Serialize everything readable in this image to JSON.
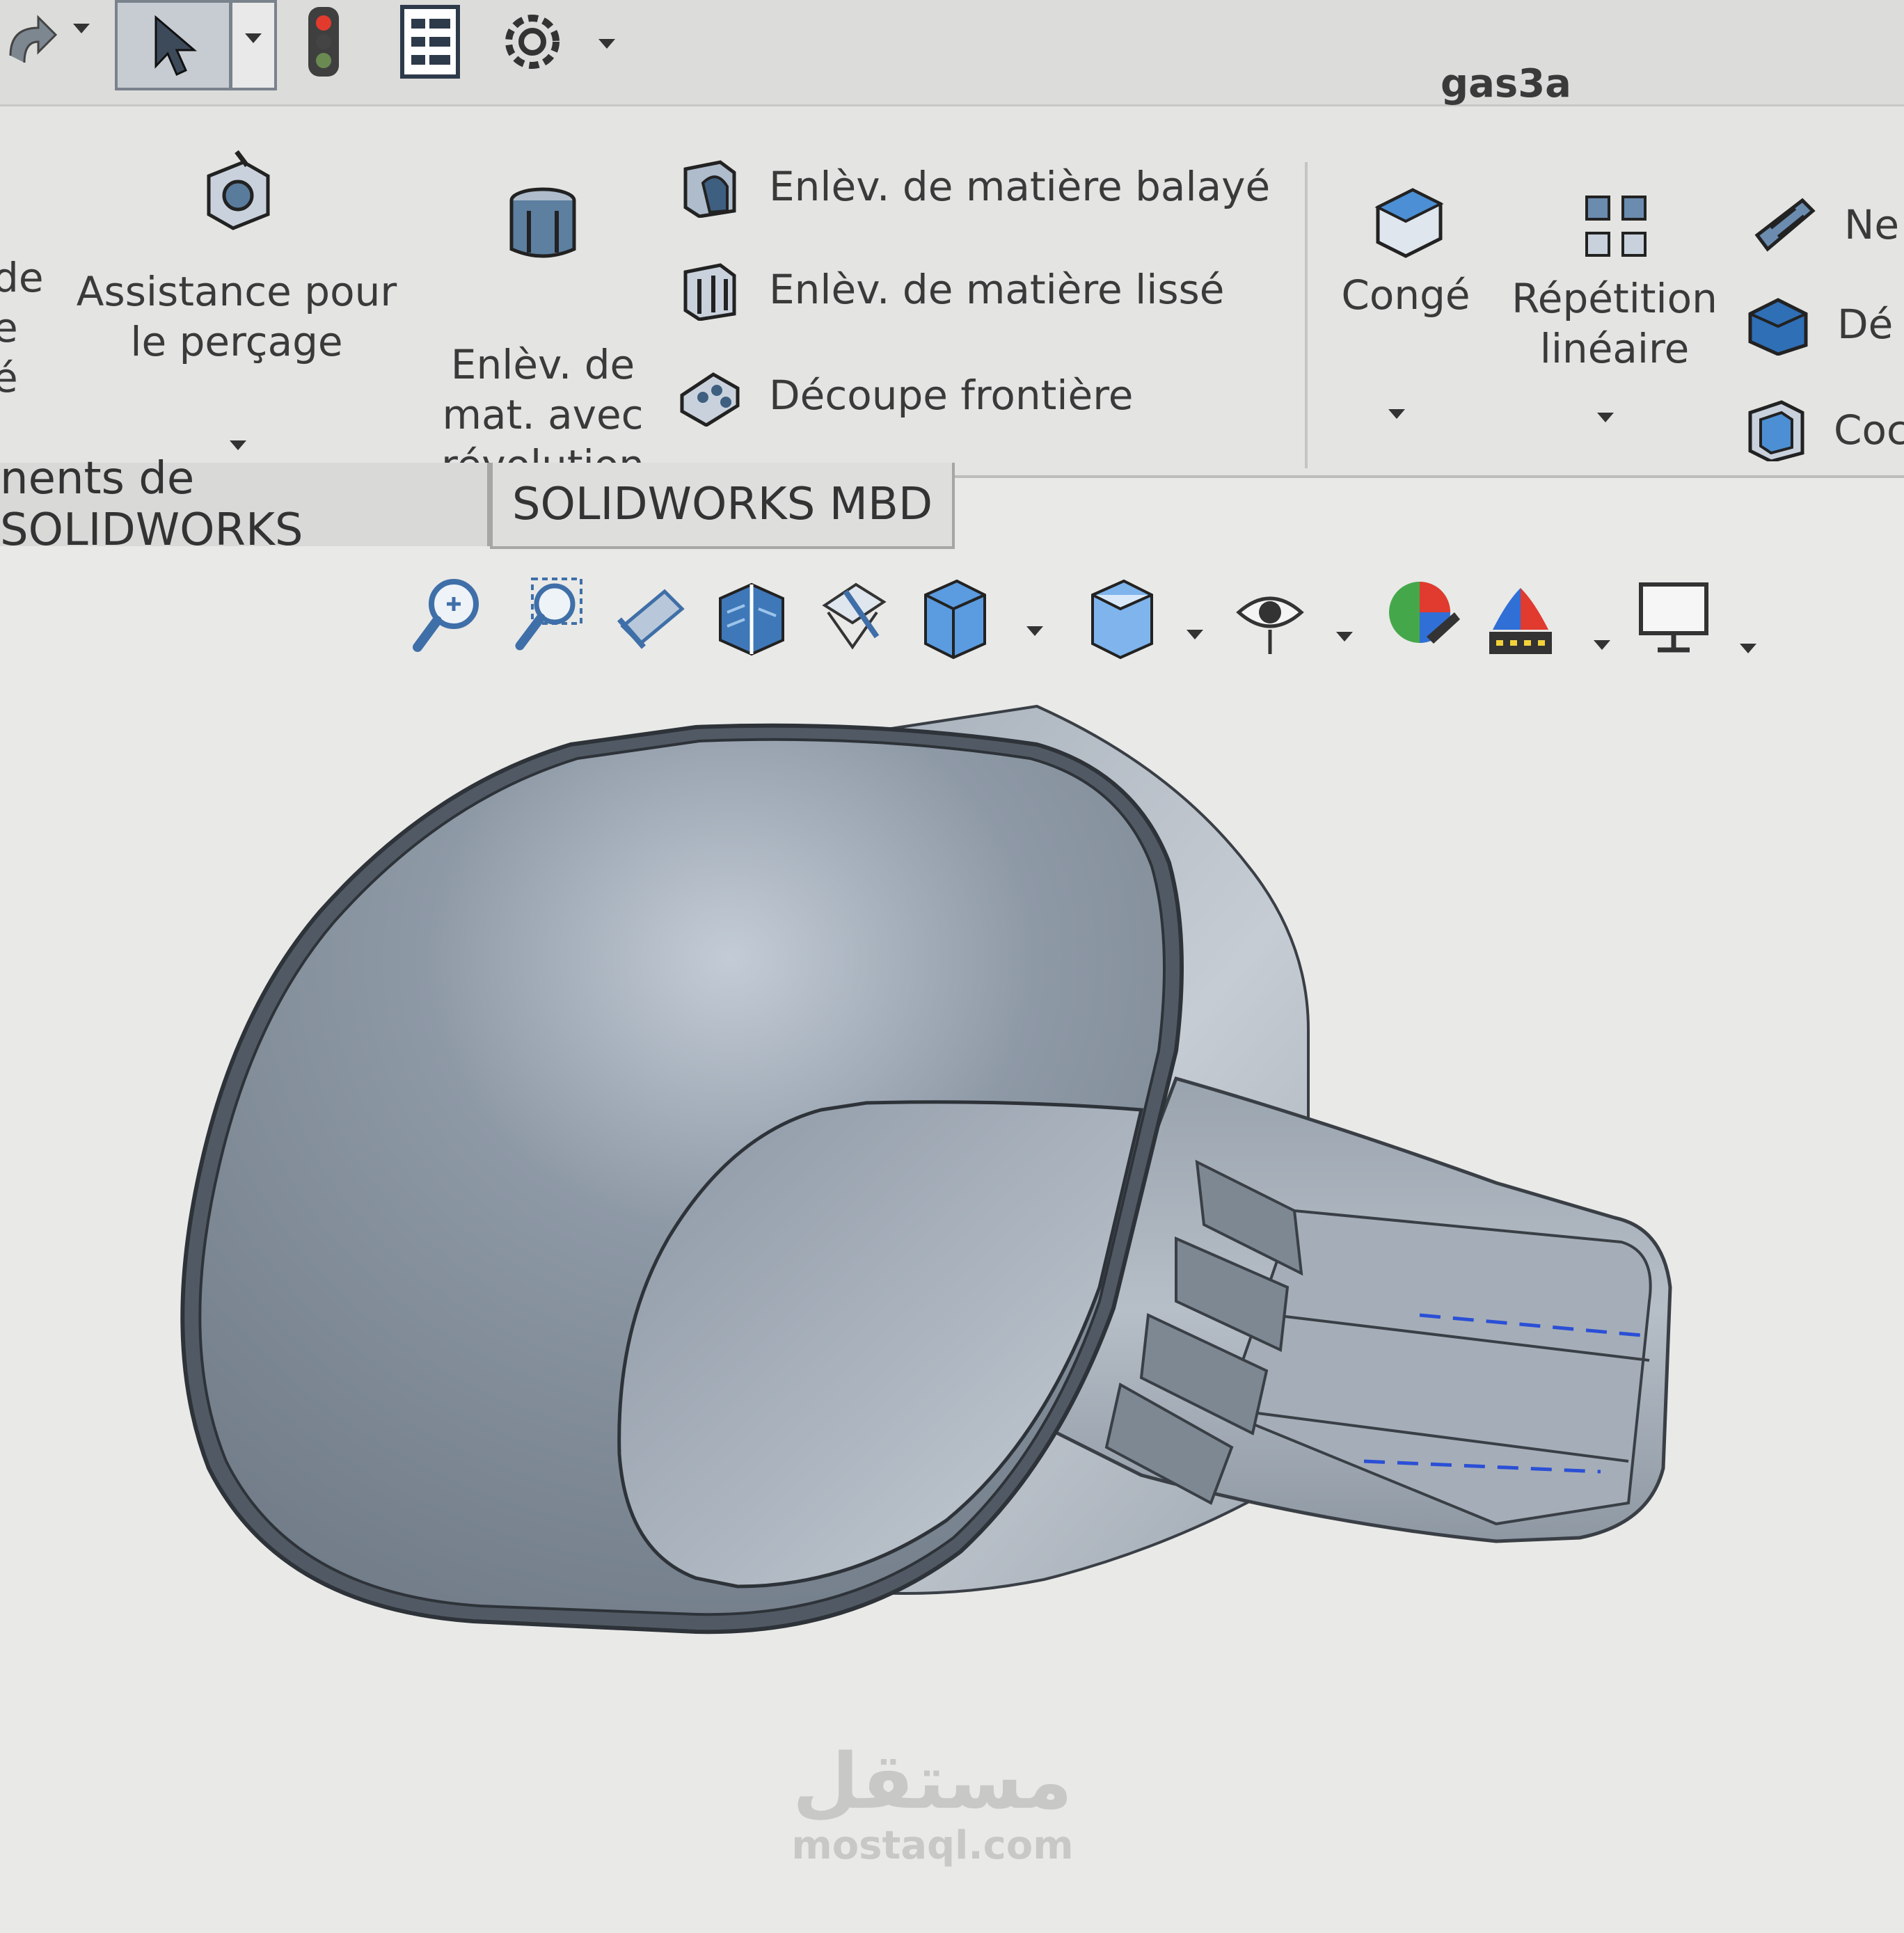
{
  "window": {
    "document_title": "gas3a"
  },
  "quick_access": {
    "items": [
      "undo-icon",
      "select-icon",
      "rebuild-icon",
      "file-properties-icon",
      "options-icon"
    ]
  },
  "ribbon": {
    "cut_left_label": "de\ne\né",
    "hole_wizard_label": "Assistance pour\nle perçage",
    "revolved_cut_label": "Enlèv. de\nmat. avec\nrévolution",
    "swept_cut_label": "Enlèv. de matière balayé",
    "lofted_cut_label": "Enlèv. de matière lissé",
    "boundary_cut_label": "Découpe frontière",
    "fillet_label": "Congé",
    "linear_pattern_label": "Répétition\nlinéaire",
    "rib_label": "Ne",
    "draft_label": "Dé",
    "shell_label": "Coc"
  },
  "tabs": {
    "addins_label": "nents de SOLIDWORKS",
    "mbd_label": "SOLIDWORKS MBD"
  },
  "hud": {
    "icons": [
      "zoom-to-fit-icon",
      "zoom-to-area-icon",
      "previous-view-icon",
      "section-view-icon",
      "dynamic-annotation-icon",
      "view-orientation-icon",
      "display-style-icon",
      "hide-show-items-icon",
      "edit-appearance-icon",
      "apply-scene-icon",
      "view-settings-icon"
    ]
  },
  "watermark": {
    "arabic": "مستقل",
    "latin": "mostaql.com"
  },
  "colors": {
    "ribbon_bg": "#e4e4e2",
    "viewport_bg": "#e9e9e7",
    "model_gray": "#8f9aa7",
    "sketch_blue": "#2b4fd6"
  }
}
